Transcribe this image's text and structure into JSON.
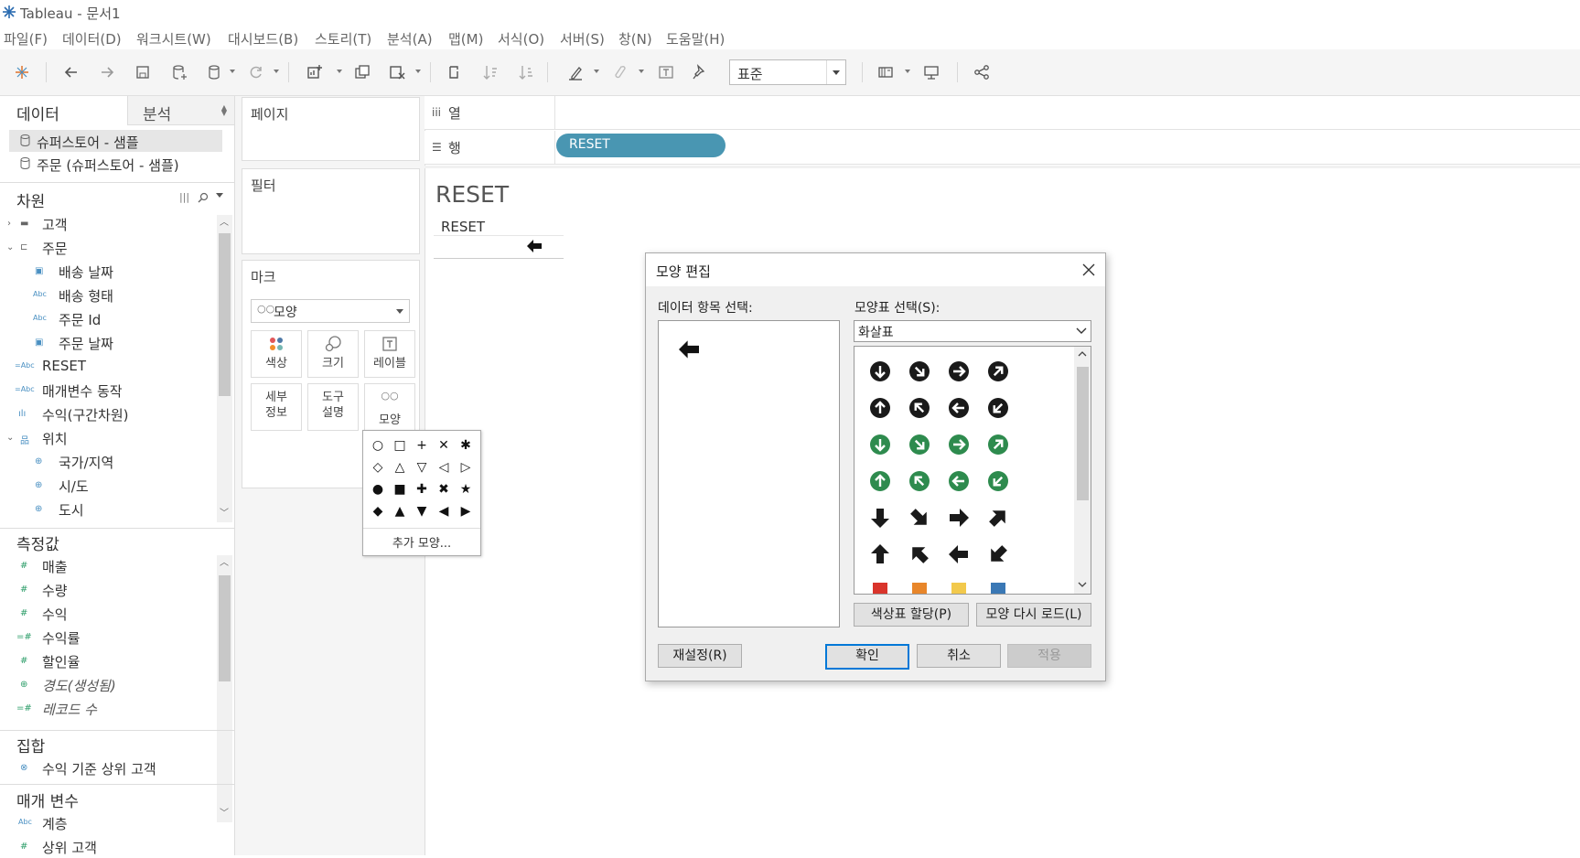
{
  "window": {
    "title": "Tableau - 문서1"
  },
  "menu": [
    "파일(F)",
    "데이터(D)",
    "워크시트(W)",
    "대시보드(B)",
    "스토리(T)",
    "분석(A)",
    "맵(M)",
    "서식(O)",
    "서버(S)",
    "창(N)",
    "도움말(H)"
  ],
  "toolbar": {
    "fit_select": "표준"
  },
  "leftpane": {
    "tab_data": "데이터",
    "tab_analysis": "분석",
    "datasources": [
      "슈퍼스토어 - 샘플",
      "주문 (슈퍼스토어 - 샘플)"
    ],
    "dimensions_header": "차원",
    "dimensions": [
      {
        "label": "고객",
        "type": "folder"
      },
      {
        "label": "주문",
        "type": "folder-open"
      },
      {
        "label": "배송 날짜",
        "type": "date"
      },
      {
        "label": "배송 형태",
        "type": "abc"
      },
      {
        "label": "주문 Id",
        "type": "abc"
      },
      {
        "label": "주문 날짜",
        "type": "date"
      },
      {
        "label": "RESET",
        "type": "abc-calc"
      },
      {
        "label": "매개변수 동작",
        "type": "abc-calc"
      },
      {
        "label": "수익(구간차원)",
        "type": "bins"
      },
      {
        "label": "위치",
        "type": "hierarchy"
      },
      {
        "label": "국가/지역",
        "type": "geo"
      },
      {
        "label": "시/도",
        "type": "geo"
      },
      {
        "label": "도시",
        "type": "geo"
      }
    ],
    "measures_header": "측정값",
    "measures": [
      {
        "label": "매출",
        "type": "num"
      },
      {
        "label": "수량",
        "type": "num"
      },
      {
        "label": "수익",
        "type": "num"
      },
      {
        "label": "수익률",
        "type": "num-calc"
      },
      {
        "label": "할인율",
        "type": "num"
      },
      {
        "label": "경도(생성됨)",
        "type": "geo"
      },
      {
        "label": "레코드 수",
        "type": "num-calc"
      }
    ],
    "sets_header": "집합",
    "sets": [
      "수익 기준 상위 고객"
    ],
    "params_header": "매개 변수",
    "params": [
      {
        "label": "계층",
        "type": "abc"
      },
      {
        "label": "상위 고객",
        "type": "num"
      }
    ]
  },
  "cards": {
    "pages": "페이지",
    "filters": "필터",
    "marks": "마크",
    "mark_type": "모양",
    "mark_buttons": {
      "color": "색상",
      "size": "크기",
      "label": "레이블",
      "detail": "세부\n정보",
      "tooltip": "도구\n설명",
      "shape": "모양"
    }
  },
  "shape_popup": {
    "rows": [
      [
        "○",
        "□",
        "+",
        "✕",
        "✱"
      ],
      [
        "◇",
        "△",
        "▽",
        "◁",
        "▷"
      ],
      [
        "●",
        "■",
        "✚",
        "✖",
        "★"
      ],
      [
        "◆",
        "▲",
        "▼",
        "◀",
        "▶"
      ]
    ],
    "more": "추가 모양..."
  },
  "shelves": {
    "columns_label": "열",
    "rows_label": "행",
    "rows_pill": "RESET"
  },
  "view": {
    "title": "RESET",
    "header": "RESET"
  },
  "dialog": {
    "title": "모양 편집",
    "select_item_label": "데이터 항목 선택:",
    "select_palette_label": "모양표 선택(S):",
    "palette_value": "화살표",
    "assign_palette": "색상표 할당(P)",
    "reload_shapes": "모양 다시 로드(L)",
    "reset": "재설정(R)",
    "ok": "확인",
    "cancel": "취소",
    "apply": "적용",
    "colors": {
      "black": "#1a1a1a",
      "green": "#2e8b4e",
      "red": "#d9342b",
      "orange": "#e8862a",
      "yellow": "#f2c94c",
      "blue": "#3a78b5"
    }
  }
}
